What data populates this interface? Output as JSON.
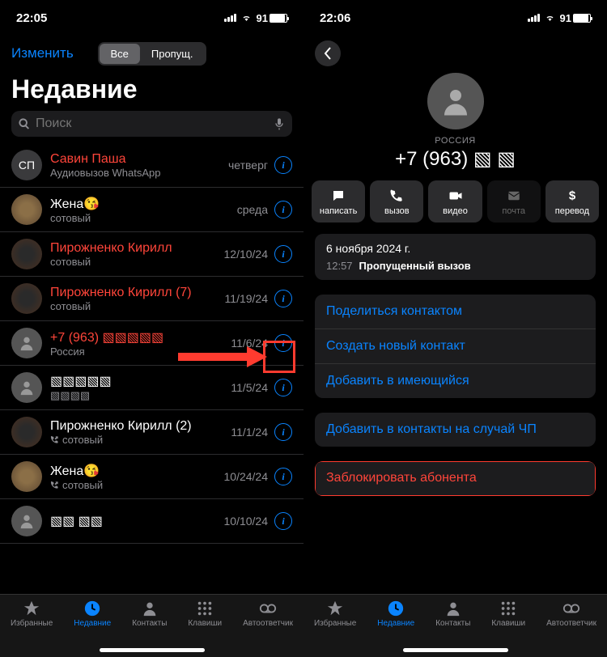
{
  "left": {
    "status": {
      "time": "22:05",
      "battery": "91"
    },
    "edit": "Изменить",
    "seg_all": "Все",
    "seg_missed": "Пропущ.",
    "title": "Недавние",
    "search_placeholder": "Поиск",
    "calls": [
      {
        "name": "Савин Паша",
        "sub": "Аудиовызов WhatsApp",
        "date": "четверг",
        "missed": true,
        "avatar": "СП",
        "avatarType": "initials"
      },
      {
        "name": "Жена😘",
        "sub": "сотовый",
        "date": "среда",
        "missed": false,
        "avatarType": "pic1"
      },
      {
        "name": "Пирожненко Кирилл",
        "sub": "сотовый",
        "date": "12/10/24",
        "missed": true,
        "avatarType": "pic2"
      },
      {
        "name": "Пирожненко Кирилл (7)",
        "sub": "сотовый",
        "date": "11/19/24",
        "missed": true,
        "avatarType": "pic2"
      },
      {
        "name": "+7 (963) ▧▧▧▧▧",
        "sub": "Россия",
        "date": "11/6/24",
        "missed": true,
        "avatarType": "gray"
      },
      {
        "name": "▧▧▧▧▧",
        "sub": "▧▧▧▧",
        "date": "11/5/24",
        "missed": false,
        "avatarType": "gray"
      },
      {
        "name": "Пирожненко Кирилл (2)",
        "sub": "сотовый",
        "date": "11/1/24",
        "missed": false,
        "outgoing": true,
        "avatarType": "pic2"
      },
      {
        "name": "Жена😘",
        "sub": "сотовый",
        "date": "10/24/24",
        "missed": false,
        "outgoing": true,
        "avatarType": "pic1"
      },
      {
        "name": "▧▧    ▧▧",
        "sub": "",
        "date": "10/10/24",
        "missed": false,
        "avatarType": "gray"
      }
    ]
  },
  "right": {
    "status": {
      "time": "22:06",
      "battery": "91"
    },
    "country": "РОССИЯ",
    "phone": "+7 (963)   ▧   ▧",
    "actions": {
      "message": "написать",
      "call": "вызов",
      "video": "видео",
      "mail": "почта",
      "pay": "перевод"
    },
    "recent": {
      "date": "6 ноября 2024 г.",
      "time": "12:57",
      "type": "Пропущенный вызов"
    },
    "links": {
      "share": "Поделиться контактом",
      "create": "Создать новый контакт",
      "add": "Добавить в имеющийся",
      "emergency": "Добавить в контакты на случай ЧП",
      "block": "Заблокировать абонента"
    }
  },
  "tabs": {
    "favorites": "Избранные",
    "recents": "Недавние",
    "contacts": "Контакты",
    "keypad": "Клавиши",
    "voicemail": "Автоответчик"
  }
}
